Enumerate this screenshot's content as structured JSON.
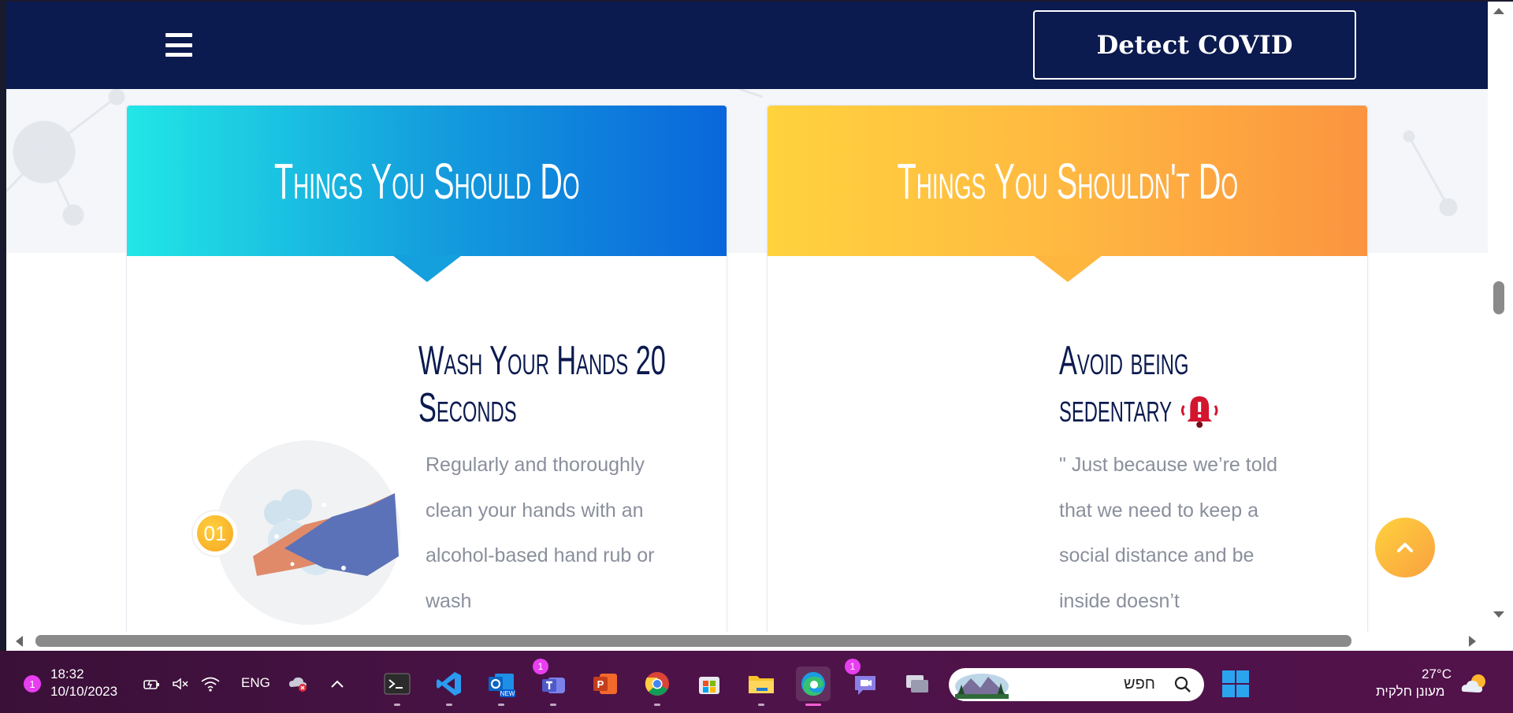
{
  "header": {
    "detect_button": "Detect COVID",
    "menu_icon": "hamburger-menu-icon"
  },
  "cards": {
    "do": {
      "title": "Things You Should Do",
      "item_title": "Wash Your Hands 20 Seconds",
      "item_number": "01",
      "item_text": "Regularly and thoroughly clean your hands with an alcohol-based hand rub or wash"
    },
    "dont": {
      "title": "Things You Shouldn't Do",
      "item_title": "Avoid being sedentary",
      "item_text": "\" Just because we’re told that we need to keep a social distance and be inside doesn’t"
    }
  },
  "colors": {
    "nav_bg": "#0b1a4f",
    "do_gradient": [
      "#22e6e6",
      "#0a66db"
    ],
    "dont_gradient": [
      "#ffd23e",
      "#fb9440"
    ],
    "accent": "#ffb841"
  },
  "taskbar": {
    "notification_count": "1",
    "time": "18:32",
    "date": "10/10/2023",
    "language": "ENG",
    "search_placeholder": "חפש",
    "weather_temp": "27°C",
    "weather_desc": "מעונן חלקית",
    "teams_badge": "1",
    "meet_badge": "1",
    "outlook_label": "NEW"
  }
}
